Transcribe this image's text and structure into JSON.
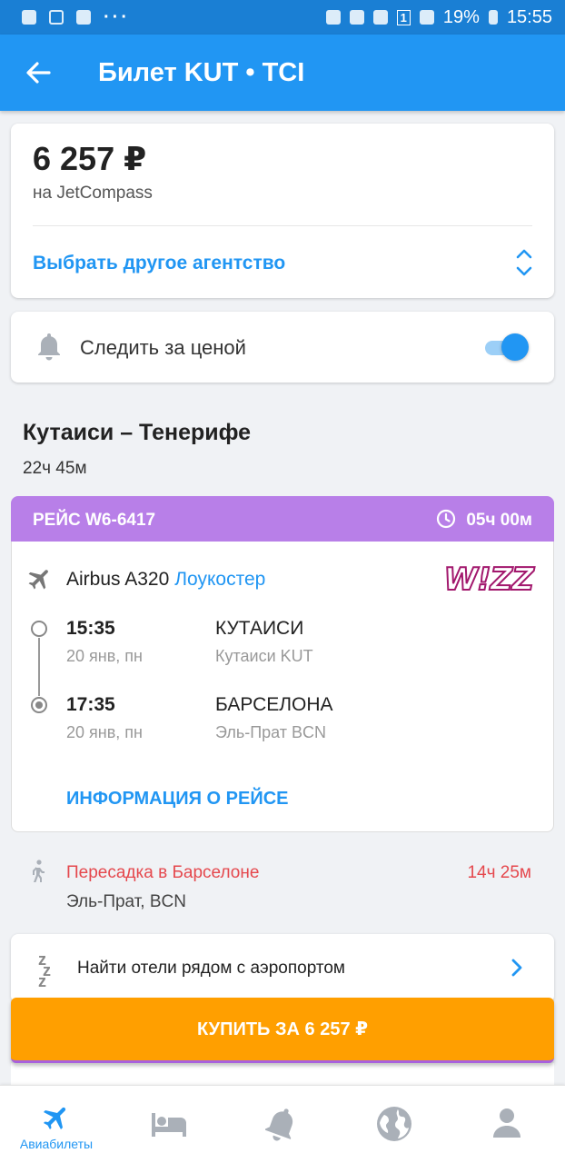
{
  "status_bar": {
    "battery": "19%",
    "time": "15:55",
    "sim_badge": "1"
  },
  "header": {
    "title": "Билет KUT • TCI"
  },
  "price_card": {
    "price": "6 257 ₽",
    "agency": "на JetCompass",
    "choose_agency": "Выбрать другое агентство"
  },
  "watch": {
    "label": "Следить за ценой",
    "enabled": true
  },
  "route": {
    "title": "Кутаиси – Тенерифе",
    "duration": "22ч 45м"
  },
  "flight": {
    "number": "РЕЙС W6-6417",
    "duration": "05ч 00м",
    "aircraft": "Airbus A320",
    "tag": "Лоукостер",
    "airline_logo": "W!ZZ",
    "departure": {
      "time": "15:35",
      "date": "20 янв, пн",
      "city": "КУТАИСИ",
      "airport": "Кутаиси KUT"
    },
    "arrival": {
      "time": "17:35",
      "date": "20 янв, пн",
      "city": "БАРСЕЛОНА",
      "airport": "Эль-Прат BCN"
    },
    "info_link": "ИНФОРМАЦИЯ О РЕЙСЕ"
  },
  "transfer": {
    "label": "Пересадка в Барселоне",
    "duration": "14ч 25м",
    "airport": "Эль-Прат, BCN"
  },
  "hotels": {
    "label": "Найти отели рядом с аэропортом"
  },
  "buy_button": "КУПИТЬ ЗА 6 257 ₽",
  "bottom_nav": {
    "items": [
      {
        "label": "Авиабилеты",
        "icon": "plane-icon",
        "active": true
      },
      {
        "label": "",
        "icon": "bed-icon",
        "active": false
      },
      {
        "label": "",
        "icon": "bell-icon",
        "active": false
      },
      {
        "label": "",
        "icon": "globe-icon",
        "active": false
      },
      {
        "label": "",
        "icon": "person-icon",
        "active": false
      }
    ]
  },
  "colors": {
    "primary": "#2196f3",
    "flight_header": "#b87fe8",
    "buy_button": "#ff9f00",
    "transfer": "#e5484d"
  }
}
